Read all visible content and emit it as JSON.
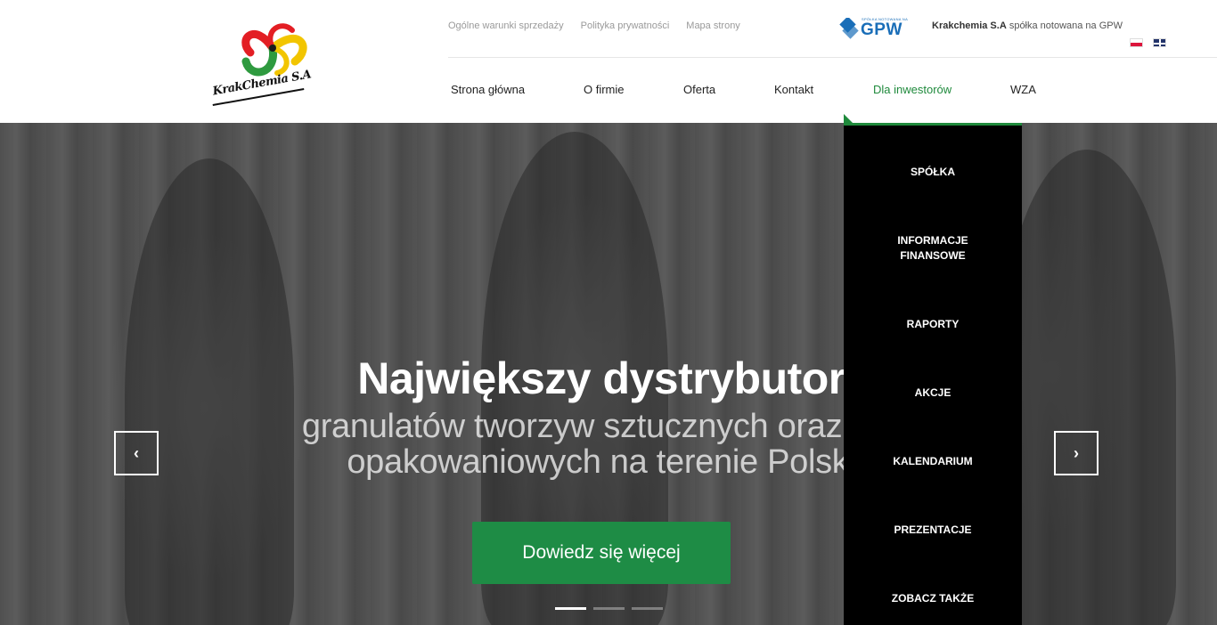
{
  "header": {
    "logo_text": "KrakChemia S.A",
    "top_links": [
      "Ogólne warunki sprzedaży",
      "Polityka prywatności",
      "Mapa strony"
    ],
    "gpw_small": "SPÓŁKA NOTOWANA NA",
    "gpw_label": "GPW",
    "company_name": "Krakchemia S.A",
    "company_note": " spółka notowana na GPW",
    "languages": [
      "pl",
      "en"
    ]
  },
  "nav": {
    "items": [
      "Strona główna",
      "O firmie",
      "Oferta",
      "Kontakt",
      "Dla inwestorów",
      "WZA"
    ],
    "active": "Dla inwestorów"
  },
  "dropdown": {
    "items": [
      "SPÓŁKA",
      "INFORMACJE FINANSOWE",
      "RAPORTY",
      "AKCJE",
      "KALENDARIUM",
      "PREZENTACJE",
      "ZOBACZ TAKŻE"
    ]
  },
  "hero": {
    "title": "Największy dystrybutor",
    "subtitle_line1": "granulatów tworzyw sztucznych oraz folii",
    "subtitle_line2": "opakowaniowych na terenie Polski",
    "cta_label": "Dowiedz się więcej",
    "prev_label": "‹",
    "next_label": "›",
    "slides": 3,
    "active_slide": 1
  },
  "colors": {
    "accent": "#1f8a3c",
    "cta": "#1e8c45",
    "gpw": "#1a6eb8",
    "dropdown_bg": "#000000"
  }
}
